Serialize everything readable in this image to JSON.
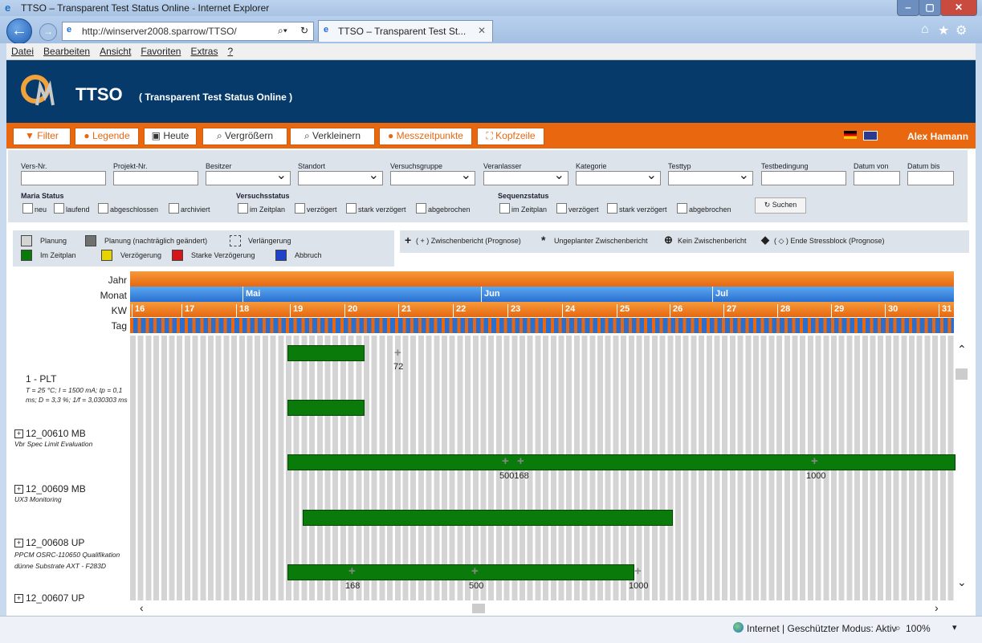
{
  "window": {
    "title": "TTSO – Transparent Test Status Online - Internet Explorer",
    "url": "http://winserver2008.sparrow/TTSO/",
    "tab_title": "TTSO – Transparent Test St..."
  },
  "menu": [
    "Datei",
    "Bearbeiten",
    "Ansicht",
    "Favoriten",
    "Extras",
    "?"
  ],
  "app": {
    "title": "TTSO",
    "subtitle": "( Transparent Test Status Online )",
    "user": "Alex Hamann"
  },
  "toolbar": {
    "filter": "Filter",
    "legende": "Legende",
    "heute": "Heute",
    "vergroessern": "Vergrößern",
    "verkleinern": "Verkleinern",
    "messzeitpunkte": "Messzeitpunkte",
    "kopfzeile": "Kopfzeile"
  },
  "filters": {
    "fields": [
      "Vers-Nr.",
      "Projekt-Nr.",
      "Besitzer",
      "Standort",
      "Versuchsgruppe",
      "Veranlasser",
      "Kategorie",
      "Testtyp",
      "Testbedingung",
      "Datum von",
      "Datum bis"
    ],
    "maria_status": {
      "label": "Maria Status",
      "options": [
        "neu",
        "laufend",
        "abgeschlossen",
        "archiviert"
      ]
    },
    "versuchsstatus": {
      "label": "Versuchsstatus",
      "options": [
        "im Zeitplan",
        "verzögert",
        "stark verzögert",
        "abgebrochen"
      ]
    },
    "sequenzstatus": {
      "label": "Sequenzstatus",
      "options": [
        "im Zeitplan",
        "verzögert",
        "stark verzögert",
        "abgebrochen"
      ]
    },
    "search": "Suchen"
  },
  "legend": {
    "planung": "Planung",
    "planung_geaendert": "Planung (nachträglich geändert)",
    "verlaengerung": "Verlängerung",
    "im_zeitplan": "Im Zeitplan",
    "verzoegerung": "Verzögerung",
    "starke_verzoegerung": "Starke Verzögerung",
    "abbruch": "Abbruch",
    "zwischenbericht": "( + ) Zwischenbericht (Prognose)",
    "ungeplant": "Ungeplanter Zwischenbericht",
    "kein": "Kein Zwischenbericht",
    "ende": "( ◇ ) Ende Stressblock (Prognose)",
    "colors": {
      "planung": "#d4d4d4",
      "planung_geaendert": "#707070",
      "im_zeitplan": "#0a7a0a",
      "verzoegerung": "#e5d400",
      "starke_verzoegerung": "#d4161b",
      "abbruch": "#1f43c8"
    }
  },
  "gantt": {
    "row_labels": {
      "jahr": "Jahr",
      "monat": "Monat",
      "kw": "KW",
      "tag": "Tag"
    },
    "months": [
      "Mai",
      "Jun",
      "Jul"
    ],
    "weeks": [
      "16",
      "17",
      "18",
      "19",
      "20",
      "21",
      "22",
      "23",
      "24",
      "25",
      "26",
      "27",
      "28",
      "29",
      "30",
      "31"
    ],
    "rows": [
      {
        "title": "1 - PLT",
        "desc": "T = 25 °C; I = 1500 mA; tp = 0,1 ms; D = 3,3 %; 1/f = 3,030303 ms"
      },
      {
        "title": "12_00610 MB",
        "desc": "Vbr Spec Limit Evaluation"
      },
      {
        "title": "12_00609 MB",
        "desc": "UX3 Monitoring"
      },
      {
        "title": "12_00608 UP",
        "desc": "PPCM OSRC-110650 Qualifikation dünne Substrate AXT - F283D"
      },
      {
        "title": "12_00607 UP",
        "desc": ""
      }
    ],
    "milestones": [
      "72",
      "500168",
      "1000",
      "168",
      "500",
      "1000"
    ]
  },
  "statusbar": {
    "zone": "Internet | Geschützter Modus: Aktiv",
    "zoom": "100%"
  }
}
